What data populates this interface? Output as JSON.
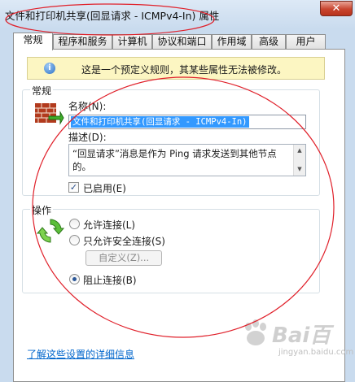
{
  "window": {
    "title": "文件和打印机共享(回显请求 - ICMPv4-In) 属性",
    "close_glyph": "✕"
  },
  "tabs": [
    {
      "label": "常规",
      "active": true
    },
    {
      "label": "程序和服务",
      "active": false
    },
    {
      "label": "计算机",
      "active": false
    },
    {
      "label": "协议和端口",
      "active": false
    },
    {
      "label": "作用域",
      "active": false
    },
    {
      "label": "高级",
      "active": false
    },
    {
      "label": "用户",
      "active": false
    }
  ],
  "info": {
    "icon": "info-icon",
    "glyph": "i",
    "text": "这是一个预定义规则，其某些属性无法被修改。"
  },
  "general_group": {
    "label": "常规",
    "icon": "firewall-rule-icon",
    "name_label": "名称(N):",
    "name_value": "文件和打印机共享(回显请求 - ICMPv4-In)",
    "desc_label": "描述(D):",
    "desc_value": "“回显请求”消息是作为 Ping 请求发送到其他节点的。",
    "enabled_label": "已启用(E)",
    "enabled_checked": true,
    "check_glyph": "✓"
  },
  "action_group": {
    "label": "操作",
    "icon": "action-arrows-icon",
    "options": [
      {
        "label": "允许连接(L)",
        "selected": false
      },
      {
        "label": "只允许安全连接(S)",
        "selected": false
      }
    ],
    "custom_button": "自定义(Z)...",
    "block_option": {
      "label": "阻止连接(B)",
      "selected": true
    }
  },
  "footer": {
    "link": "了解这些设置的详细信息"
  },
  "watermark": {
    "text": "Bai百",
    "sub": "jingyan.baidu.com"
  },
  "colors": {
    "annotation": "#e0202a",
    "link": "#0066cc",
    "selection": "#3399ff",
    "infobar": "#fcf6c2"
  }
}
